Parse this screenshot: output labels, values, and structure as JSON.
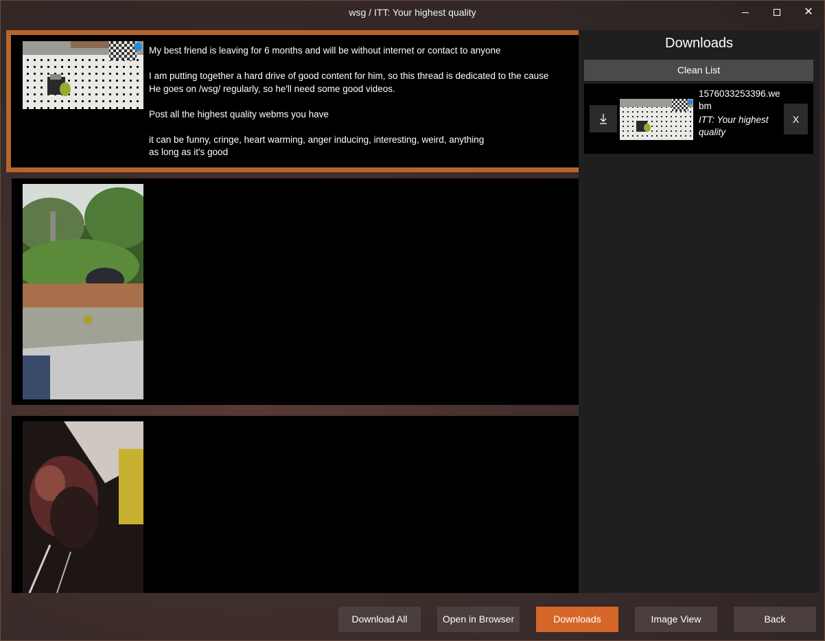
{
  "window": {
    "title": "wsg / ITT: Your highest quality",
    "close_glyph": "✕"
  },
  "thread": {
    "posts": [
      {
        "selected": true,
        "lines": [
          "My best friend is leaving for 6 months and will be without internet or contact to anyone",
          "",
          "I am putting together a hard drive of good content for him, so this thread is dedicated to the cause",
          "He goes on /wsg/ regularly, so he'll need some good videos.",
          "",
          "Post all the highest quality webms you have",
          "",
          "it can be funny, cringe, heart warming, anger inducing, interesting, weird, anything",
          "as long as it's good"
        ]
      },
      {
        "selected": false,
        "lines": []
      },
      {
        "selected": false,
        "lines": []
      }
    ]
  },
  "downloads": {
    "title": "Downloads",
    "clean_label": "Clean List",
    "items": [
      {
        "file_name": "1576033253396.webm",
        "thread_name": "ITT: Your highest quality",
        "remove_label": "X"
      }
    ]
  },
  "bottom_bar": {
    "download_all_label": "Download All",
    "open_browser_label": "Open in Browser",
    "downloads_label": "Downloads",
    "image_view_label": "Image View",
    "back_label": "Back"
  },
  "colors": {
    "accent": "#d5672a",
    "selection_border": "#b5652b",
    "panel_bg": "#1f1f1f",
    "button_bg": "#4a3f3e"
  }
}
